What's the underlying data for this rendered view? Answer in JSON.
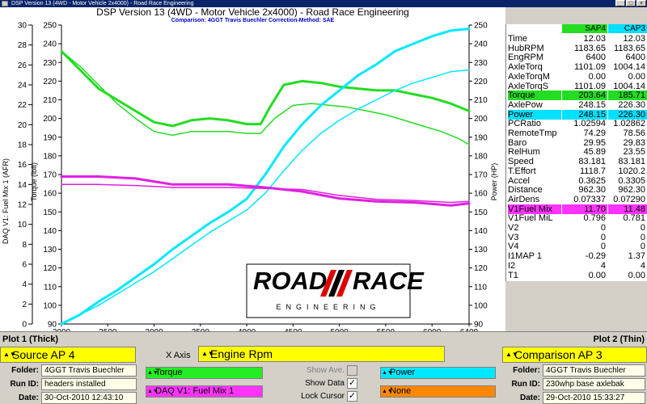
{
  "window": {
    "title": "DSP Version 13 (4WD - Motor Vehicle 2x4000) - Road Race Engineering"
  },
  "chart_data": {
    "type": "line",
    "title": "DSP Version 13 (4WD - Motor Vehicle 2x4000) - Road Race Engineering",
    "subtitle": "Comparison: 4GGT Travis Buechler    Correction-Method: SAE",
    "xlabel": "",
    "x_ticks": [
      "2000",
      "2500",
      "3000",
      "3500",
      "4000",
      "4500",
      "5000",
      "5500",
      "6000",
      "6400"
    ],
    "xlim": [
      2000,
      6400
    ],
    "axes": {
      "daq": {
        "label": "DAQ V1: Fuel Mix 1 (AFR)",
        "ticks": [
          "30",
          "28",
          "26",
          "24",
          "22",
          "20",
          "18",
          "16",
          "14",
          "12",
          "10",
          "8",
          "6",
          "4",
          "2",
          "0"
        ],
        "ylim": [
          0,
          30
        ]
      },
      "torque": {
        "label": "Torque (lbft)",
        "ticks": [
          "250",
          "240",
          "230",
          "220",
          "210",
          "200",
          "190",
          "180",
          "170",
          "160",
          "150",
          "140",
          "130",
          "120",
          "110",
          "100",
          "90"
        ],
        "ylim": [
          90,
          250
        ]
      },
      "power": {
        "label": "Power (HP)",
        "ticks": [
          "250",
          "240",
          "230",
          "220",
          "210",
          "200",
          "190",
          "180",
          "170",
          "160",
          "150",
          "140",
          "130",
          "120",
          "110",
          "100",
          "90"
        ],
        "ylim": [
          90,
          250
        ]
      }
    },
    "grid": false,
    "series": [
      {
        "name": "Torque",
        "run": "SAP4",
        "axis": "torque",
        "color": "#22dd22",
        "width": 3,
        "x": [
          2000,
          2200,
          2400,
          2600,
          2800,
          3000,
          3200,
          3400,
          3600,
          3800,
          4000,
          4150,
          4250,
          4400,
          4600,
          4800,
          5000,
          5200,
          5400,
          5600,
          5800,
          6000,
          6200,
          6400
        ],
        "y": [
          236,
          226,
          216,
          210,
          204,
          198,
          196,
          199,
          200,
          199,
          197,
          197,
          206,
          218,
          220,
          219,
          217,
          216,
          215,
          215,
          213,
          211,
          208,
          204
        ]
      },
      {
        "name": "Torque",
        "run": "CAP3",
        "axis": "torque",
        "color": "#22dd22",
        "width": 1.5,
        "x": [
          2000,
          2200,
          2400,
          2600,
          2800,
          3000,
          3200,
          3400,
          3600,
          3800,
          4000,
          4150,
          4300,
          4500,
          4700,
          4900,
          5100,
          5300,
          5500,
          5700,
          5900,
          6100,
          6300,
          6400
        ],
        "y": [
          236,
          228,
          218,
          208,
          200,
          193,
          191,
          193,
          193,
          193,
          192,
          192,
          200,
          207,
          208,
          207,
          206,
          204,
          202,
          199,
          196,
          193,
          189,
          186
        ]
      },
      {
        "name": "Power",
        "run": "SAP4",
        "axis": "power",
        "color": "#00e8ff",
        "width": 3,
        "x": [
          2000,
          2200,
          2400,
          2600,
          2800,
          3000,
          3200,
          3400,
          3600,
          3800,
          4000,
          4200,
          4400,
          4600,
          4800,
          5000,
          5200,
          5400,
          5600,
          5800,
          6000,
          6200,
          6400
        ],
        "y": [
          90,
          95,
          102,
          108,
          115,
          122,
          130,
          137,
          144,
          150,
          157,
          170,
          185,
          197,
          207,
          215,
          223,
          229,
          236,
          240,
          244,
          247,
          248
        ]
      },
      {
        "name": "Power",
        "run": "CAP3",
        "axis": "power",
        "color": "#00e8ff",
        "width": 1.5,
        "x": [
          2000,
          2200,
          2400,
          2600,
          2800,
          3000,
          3200,
          3400,
          3600,
          3800,
          4000,
          4200,
          4400,
          4600,
          4800,
          5000,
          5200,
          5400,
          5600,
          5800,
          6000,
          6200,
          6400
        ],
        "y": [
          90,
          95,
          100,
          106,
          112,
          118,
          125,
          132,
          139,
          145,
          151,
          160,
          172,
          183,
          192,
          199,
          205,
          210,
          215,
          219,
          222,
          225,
          226
        ]
      },
      {
        "name": "DAQ V1: Fuel Mix 1",
        "run": "SAP4",
        "axis": "daq",
        "color": "#e020e0",
        "width": 3,
        "x": [
          2000,
          2400,
          2800,
          3000,
          3200,
          3400,
          3800,
          4200,
          4600,
          5000,
          5400,
          5800,
          6200,
          6400
        ],
        "y": [
          14.8,
          14.8,
          14.6,
          14.3,
          14.0,
          14.0,
          14.0,
          13.7,
          13.3,
          12.6,
          12.3,
          12.2,
          11.9,
          12.1
        ]
      },
      {
        "name": "DAQ V1: Fuel Mix 1",
        "run": "CAP3",
        "axis": "daq",
        "color": "#e020e0",
        "width": 1.5,
        "x": [
          2000,
          2400,
          2800,
          3000,
          3200,
          3400,
          3800,
          4200,
          4600,
          5000,
          5400,
          5800,
          6200,
          6400
        ],
        "y": [
          14.0,
          14.0,
          13.9,
          13.8,
          13.7,
          13.7,
          13.7,
          13.6,
          13.5,
          12.9,
          12.5,
          12.4,
          12.2,
          12.3
        ]
      }
    ]
  },
  "logo": {
    "text_left": "ROAD",
    "text_right": "RACE",
    "tagline": "ENGINEERING"
  },
  "table": {
    "headers": [
      "SAP4",
      "CAP3"
    ],
    "rows": [
      {
        "label": "Time",
        "v1": "12.03",
        "v2": "12.03",
        "hl": ""
      },
      {
        "label": "HubRPM",
        "v1": "1183.65",
        "v2": "1183.65",
        "hl": ""
      },
      {
        "label": "EngRPM",
        "v1": "6400",
        "v2": "6400",
        "hl": ""
      },
      {
        "label": "AxleTorq",
        "v1": "1101.09",
        "v2": "1004.14",
        "hl": ""
      },
      {
        "label": "AxleTorqM",
        "v1": "0.00",
        "v2": "0.00",
        "hl": ""
      },
      {
        "label": "AxleTorqS",
        "v1": "1101.09",
        "v2": "1004.14",
        "hl": ""
      },
      {
        "label": "Torque",
        "v1": "203.64",
        "v2": "185.71",
        "hl": "green"
      },
      {
        "label": "AxlePow",
        "v1": "248.15",
        "v2": "226.30",
        "hl": ""
      },
      {
        "label": "Power",
        "v1": "248.15",
        "v2": "226.30",
        "hl": "cyan"
      },
      {
        "label": "PCRatio",
        "v1": "1.02594",
        "v2": "1.02862",
        "hl": ""
      },
      {
        "label": "RemoteTmp",
        "v1": "74.29",
        "v2": "78.56",
        "hl": ""
      },
      {
        "label": "Baro",
        "v1": "29.95",
        "v2": "29.83",
        "hl": ""
      },
      {
        "label": "RelHum",
        "v1": "45.89",
        "v2": "23.55",
        "hl": ""
      },
      {
        "label": "Speed",
        "v1": "83.181",
        "v2": "83.181",
        "hl": ""
      },
      {
        "label": "T.Effort",
        "v1": "1118.7",
        "v2": "1020.2",
        "hl": ""
      },
      {
        "label": "Accel",
        "v1": "0.3625",
        "v2": "0.3305",
        "hl": ""
      },
      {
        "label": "Distance",
        "v1": "962.30",
        "v2": "962.30",
        "hl": ""
      },
      {
        "label": "AirDens",
        "v1": "0.07337",
        "v2": "0.07290",
        "hl": ""
      },
      {
        "label": "V1Fuel Mix",
        "v1": "11.70",
        "v2": "11.48",
        "hl": "magenta"
      },
      {
        "label": "V1Fuel MiL",
        "v1": "0.796",
        "v2": "0.781",
        "hl": ""
      },
      {
        "label": "V2",
        "v1": "0",
        "v2": "0",
        "hl": ""
      },
      {
        "label": "V3",
        "v1": "0",
        "v2": "0",
        "hl": ""
      },
      {
        "label": "V4",
        "v1": "0",
        "v2": "0",
        "hl": ""
      },
      {
        "label": "I1MAP 1",
        "v1": "-0.29",
        "v2": "1.37",
        "hl": ""
      },
      {
        "label": "I2",
        "v1": "4",
        "v2": "4",
        "hl": ""
      },
      {
        "label": "T1",
        "v1": "0.00",
        "v2": "0.00",
        "hl": ""
      }
    ]
  },
  "controls": {
    "plot1_label": "Plot 1 (Thick)",
    "plot2_label": "Plot 2 (Thin)",
    "source_value": "Source AP 4",
    "comparison_value": "Comparison AP 3",
    "xaxis_label": "X Axis",
    "xaxis_value": "Engine Rpm",
    "folder_label": "Folder:",
    "runid_label": "Run ID:",
    "date_label": "Date:",
    "left_folder": "4GGT Travis Buechler",
    "left_runid": "headers installed",
    "left_date": "30-Oct-2010 12:43:10",
    "right_folder": "4GGT Travis Buechler",
    "right_runid": "230whp base axlebak",
    "right_date": "29-Oct-2010 15:33:27",
    "channel1": "Torque",
    "channel2": "Power",
    "channel3": "DAQ V1: Fuel Mix 1",
    "channel4": "None",
    "show_ave_label": "Show Ave.",
    "show_data_label": "Show Data",
    "lock_cursor_label": "Lock Cursor",
    "check_mark": "✓",
    "arrow_glyph": "▲▼",
    "colors": {
      "channel1": "#22ee22",
      "channel2": "#00e8ff",
      "channel3": "#ff33ff",
      "channel4": "#ff8800"
    }
  }
}
